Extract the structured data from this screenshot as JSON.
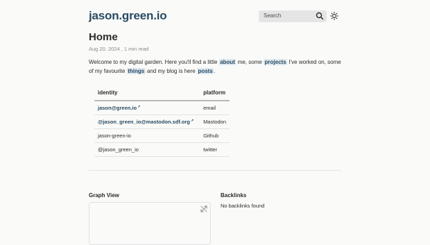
{
  "header": {
    "site_title": "jason.green.io",
    "search_placeholder": "Search",
    "search_icon": "search-icon",
    "theme_icon": "sun-icon"
  },
  "page": {
    "title": "Home",
    "date": "Aug 20, 2024",
    "read_time": "1 min read"
  },
  "intro": {
    "t1": "Welcome to my digital garden. Here you'll find a little ",
    "link_about": "about",
    "t2": " me, some ",
    "link_projects": "projects",
    "t3": " I've worked on, some of my favourite ",
    "link_things": "things",
    "t4": " and my blog is here ",
    "link_posts": "posts",
    "t5": "."
  },
  "table": {
    "headers": [
      "identity",
      "platform"
    ],
    "rows": [
      {
        "identity": "jason@green.io",
        "platform": "email",
        "link": true
      },
      {
        "identity": "@jason_green_io@mastodon.sdf.org",
        "platform": "Mastodon",
        "link": true
      },
      {
        "identity": "jason-green-io",
        "platform": "Github",
        "link": false
      },
      {
        "identity": "@jason_green_io",
        "platform": "twitter",
        "link": false
      }
    ]
  },
  "graph": {
    "title": "Graph View",
    "expand_icon": "expand-icon"
  },
  "backlinks": {
    "title": "Backlinks",
    "empty_text": "No backlinks found"
  },
  "colors": {
    "accent": "#284b63",
    "link_bg": "#dfe8ef",
    "search_bg": "#e5e5e5"
  }
}
